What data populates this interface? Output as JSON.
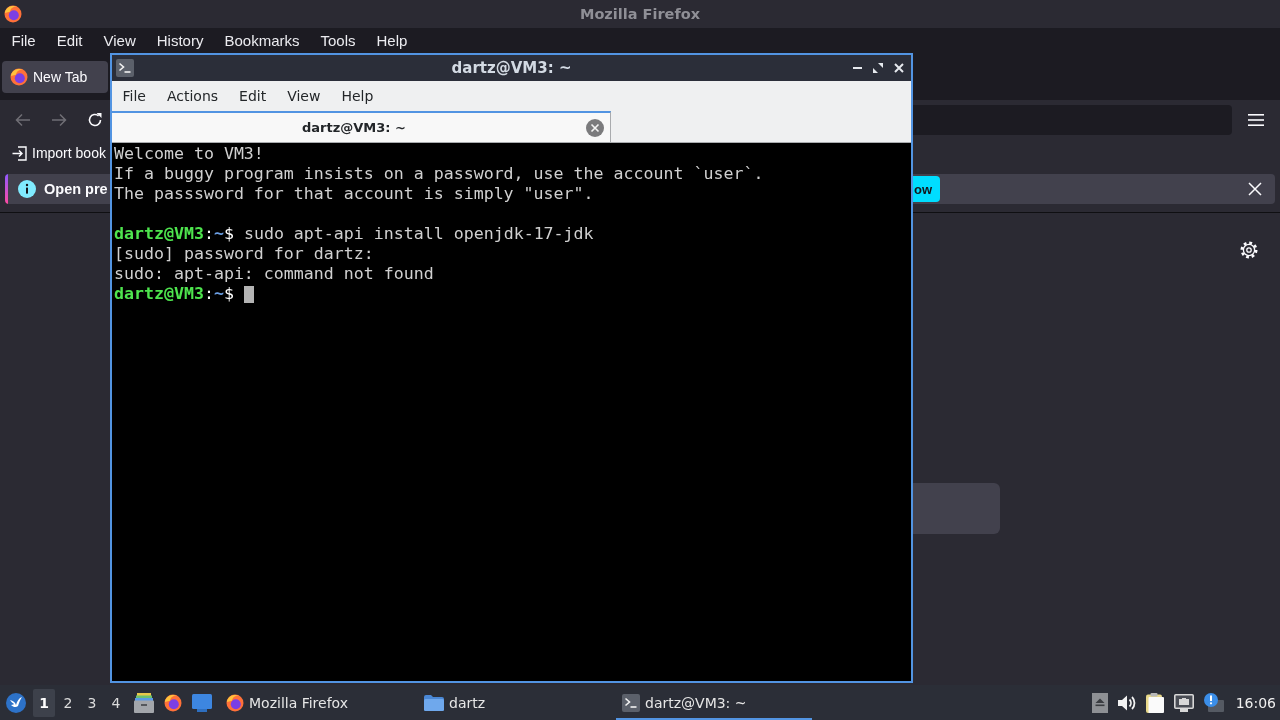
{
  "firefox": {
    "title": "Mozilla Firefox",
    "menu": [
      "File",
      "Edit",
      "View",
      "History",
      "Bookmarks",
      "Tools",
      "Help"
    ],
    "tabs": [
      {
        "label": "New Tab",
        "selected": true
      }
    ],
    "bookmarks_toolbar": [
      {
        "label": "Import book"
      }
    ],
    "notification": {
      "text": "Open pre",
      "button": "ow"
    }
  },
  "terminal": {
    "title": "dartz@VM3: ~",
    "menu": [
      "File",
      "Actions",
      "Edit",
      "View",
      "Help"
    ],
    "tabs": [
      {
        "label": "dartz@VM3: ~",
        "selected": true
      }
    ],
    "lines": [
      {
        "kind": "output",
        "text": "Welcome to VM3!"
      },
      {
        "kind": "output",
        "text": "If a buggy program insists on a password, use the account `user`."
      },
      {
        "kind": "output",
        "text": "The passsword for that account is simply \"user\"."
      },
      {
        "kind": "blank"
      },
      {
        "kind": "prompt",
        "user": "dartz@VM3",
        "separator": ":",
        "path": "~",
        "symbol": "$",
        "command": "sudo apt-api install openjdk-17-jdk",
        "cursor": false
      },
      {
        "kind": "output",
        "text": "[sudo] password for dartz:"
      },
      {
        "kind": "output",
        "text": "sudo: apt-api: command not found"
      },
      {
        "kind": "prompt",
        "user": "dartz@VM3",
        "separator": ":",
        "path": "~",
        "symbol": "$",
        "cursor": true
      }
    ]
  },
  "taskbar": {
    "workspaces": [
      {
        "label": "1",
        "selected": true
      },
      {
        "label": "2",
        "selected": false
      },
      {
        "label": "3",
        "selected": false
      },
      {
        "label": "4",
        "selected": false
      }
    ],
    "tasks": [
      {
        "kind": "browser",
        "label": "Mozilla Firefox",
        "selected": false
      },
      {
        "kind": "folder",
        "label": "dartz",
        "selected": false
      },
      {
        "kind": "terminal",
        "label": "dartz@VM3: ~",
        "selected": true
      }
    ],
    "clock": "16:06"
  }
}
